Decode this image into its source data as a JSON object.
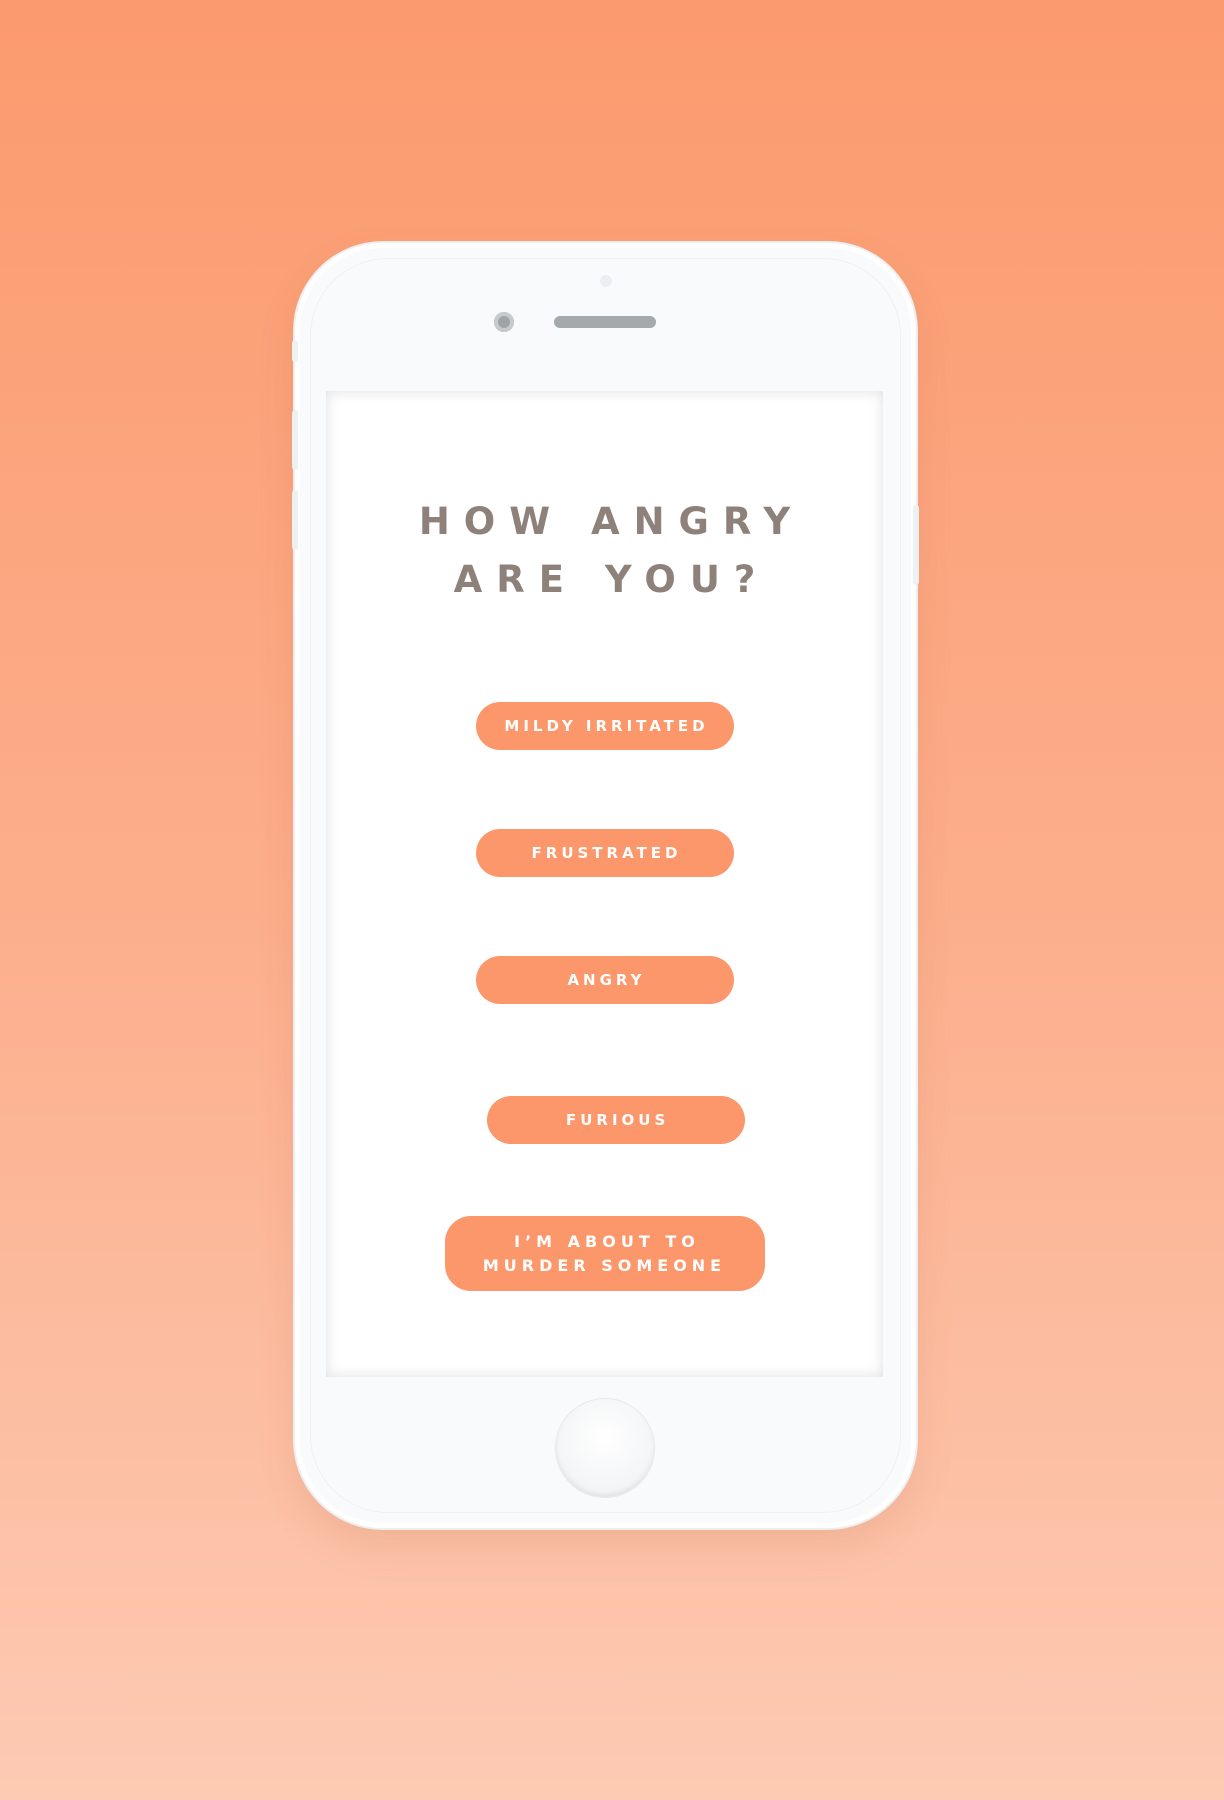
{
  "colors": {
    "accent": "#fb976b",
    "question_text": "#8d817a",
    "button_text": "#ffffff",
    "background_top": "#fb9a6e",
    "background_bottom": "#fdcab3"
  },
  "screen": {
    "question_line1": "HOW ANGRY",
    "question_line2": "ARE YOU?",
    "options": [
      {
        "label": "MILDY IRRITATED"
      },
      {
        "label": "FRUSTRATED"
      },
      {
        "label": "ANGRY"
      },
      {
        "label": "FURIOUS"
      },
      {
        "label": "I’M ABOUT TO MURDER SOMEONE"
      }
    ]
  }
}
